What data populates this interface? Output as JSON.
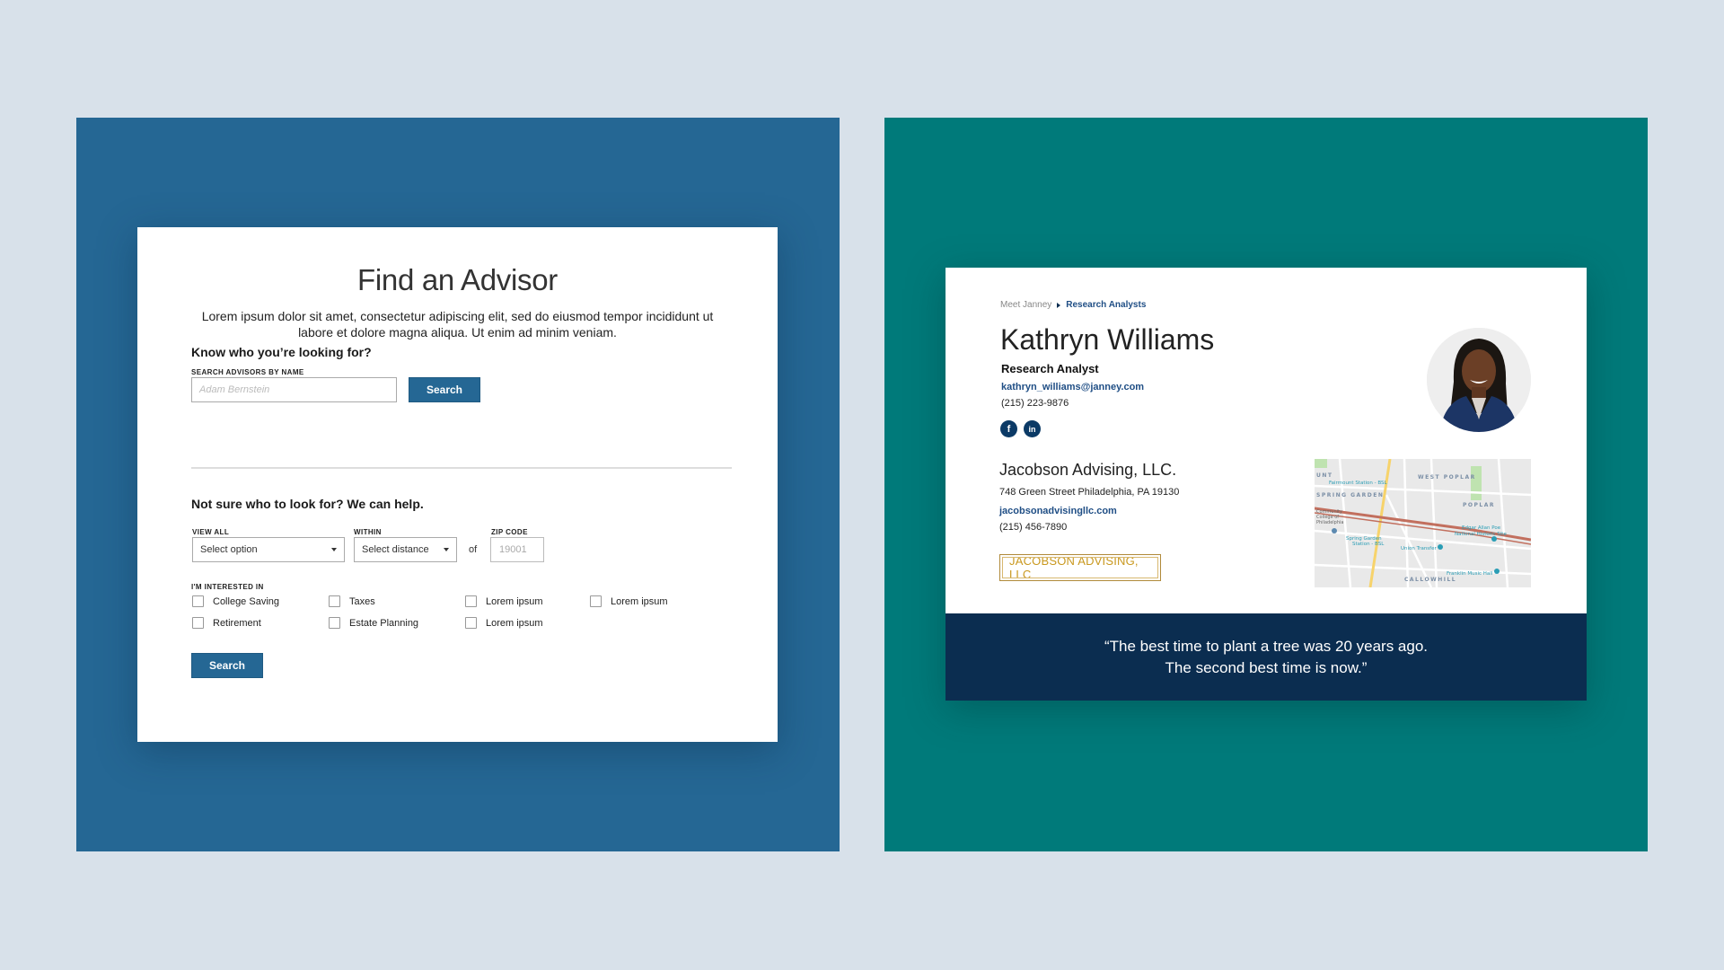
{
  "colors": {
    "page_bg": "#d8e1ea",
    "left_panel": "#256794",
    "right_panel": "#007a7a",
    "primary_button": "#256794",
    "navy": "#0b2d50",
    "link": "#1f4e85",
    "logo_gold": "#c9981e"
  },
  "find_advisor": {
    "title": "Find an Advisor",
    "description": "Lorem ipsum dolor sit amet, consectetur adipiscing elit, sed do eiusmod tempor incididunt ut labore et dolore magna aliqua. Ut enim ad minim veniam.",
    "known_section": {
      "heading": "Know who you’re looking for?",
      "name_label": "SEARCH ADVISORS BY NAME",
      "name_placeholder": "Adam Bernstein",
      "name_value": "",
      "search_label": "Search"
    },
    "help_section": {
      "heading": "Not sure who to look for? We can help.",
      "view_all_label": "VIEW ALL",
      "view_all_value": "Select option",
      "within_label": "WITHIN",
      "within_value": "Select distance",
      "of_text": "of",
      "zip_label": "ZIP CODE",
      "zip_placeholder": "19001",
      "interests_label": "I'M INTERESTED IN",
      "interests": [
        {
          "label": "College Saving",
          "checked": false
        },
        {
          "label": "Taxes",
          "checked": false
        },
        {
          "label": "Lorem ipsum",
          "checked": false
        },
        {
          "label": "Lorem ipsum",
          "checked": false
        },
        {
          "label": "Retirement",
          "checked": false
        },
        {
          "label": "Estate Planning",
          "checked": false
        },
        {
          "label": "Lorem ipsum",
          "checked": false
        }
      ],
      "search_label": "Search"
    }
  },
  "profile": {
    "breadcrumb": [
      {
        "label": "Meet Janney"
      },
      {
        "label": "Research Analysts"
      }
    ],
    "name": "Kathryn Williams",
    "title": "Research Analyst",
    "email": "kathryn_williams@janney.com",
    "phone": "(215) 223-9876",
    "social": [
      {
        "icon": "facebook-icon",
        "glyph": "f"
      },
      {
        "icon": "linkedin-icon",
        "glyph": "in"
      }
    ],
    "avatar": "avatar-photo",
    "company": {
      "name": "Jacobson Advising, LLC.",
      "address": "748 Green Street Philadelphia, PA 19130",
      "website": "jacobsonadvisingllc.com",
      "phone": "(215) 456-7890",
      "logo_text": "JACOBSON ADVISING, LLC"
    },
    "map": {
      "labels": [
        "UNT",
        "Fairmount Station - BSL",
        "WEST POPLAR",
        "SPRING GARDEN",
        "POPLAR",
        "Community College of Philadelphia",
        "Edgar Allan Poe National Historic Site",
        "Spring Garden Station - BSL",
        "Union Transfer",
        "Franklin Music Hall",
        "CALLOWHILL"
      ]
    },
    "quote_line1": "“The best time to plant a tree was 20 years ago.",
    "quote_line2": "The second best time is now.”"
  }
}
